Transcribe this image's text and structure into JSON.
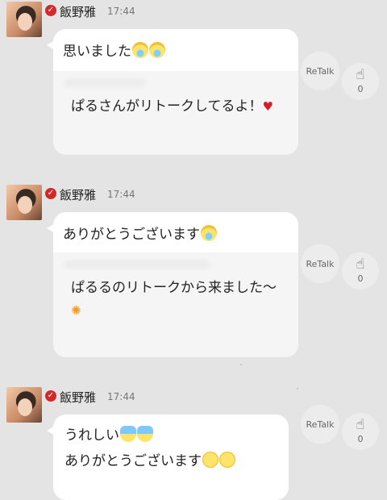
{
  "posts": [
    {
      "username": "飯野雅",
      "time": "17:44",
      "message": "思いました",
      "quote_text": "ぱるさんがリトークしてるよ！",
      "retalk_label": "ReTalk",
      "clap_count": "0"
    },
    {
      "username": "飯野雅",
      "time": "17:44",
      "message": "ありがとうございます",
      "quote_text": "ぱるるのリトークから来ました〜",
      "retalk_label": "ReTalk",
      "clap_count": "0"
    },
    {
      "username": "飯野雅",
      "time": "17:44",
      "message_line1": "うれしい",
      "message_line2": "ありがとうございます",
      "retalk_label": "ReTalk",
      "clap_count": "0"
    }
  ],
  "icons": {
    "verified": "check-badge-icon",
    "clap": "clapping-hands-icon",
    "emoji_cry": "crying-face-emoji",
    "emoji_scream": "screaming-face-emoji",
    "emoji_dizzy": "dizzy-face-emoji",
    "heart": "heart-icon",
    "flower": "flower-icon"
  },
  "colors": {
    "background": "#e4e4e4",
    "bubble": "#ffffff",
    "badge": "#d12a2a",
    "heart": "#d81b2c"
  }
}
